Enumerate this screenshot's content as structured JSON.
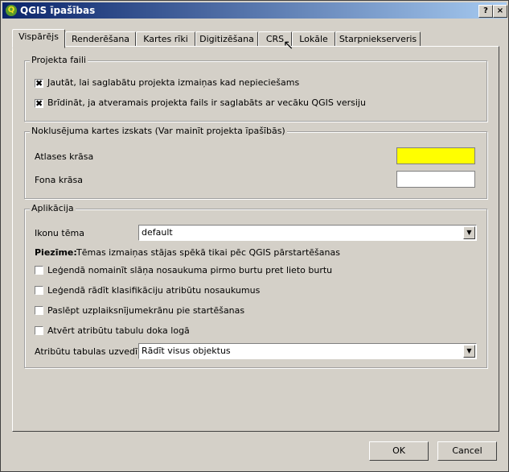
{
  "window": {
    "title": "QGIS īpašības",
    "help_label": "?",
    "close_label": "×",
    "app_icon_glyph": "Q"
  },
  "tabs": [
    {
      "label": "Vispārējs",
      "active": true
    },
    {
      "label": "Renderēšana"
    },
    {
      "label": "Kartes rīki"
    },
    {
      "label": "Digitizēšana"
    },
    {
      "label": "CRS"
    },
    {
      "label": "Lokāle"
    },
    {
      "label": "Starpniekserveris"
    }
  ],
  "project_files": {
    "title": "Projekta faili",
    "prompt_save": {
      "label": "Jautāt, lai saglabātu projekta izmaiņas kad nepieciešams",
      "checked": true
    },
    "warn_old": {
      "label": "Brīdināt, ja atveramais projekta fails ir saglabāts ar vecāku QGIS versiju",
      "checked": true
    }
  },
  "defaults": {
    "title": "Noklusējuma kartes izskats (Var mainīt projekta īpašībās)",
    "selection_color": {
      "label": "Atlases krāsa",
      "color": "#ffff00"
    },
    "background_color": {
      "label": "Fona krāsa",
      "color": "#ffffff"
    }
  },
  "application": {
    "title": "Aplikācija",
    "icon_theme": {
      "label": "Ikonu tēma",
      "value": "default"
    },
    "note_bold": "Piezīme:",
    "note_text": "Tēmas izmaiņas stājas spēkā tikai pēc QGIS pārstartēšanas",
    "checkboxes": [
      {
        "label": "Leģendā nomainīt slāņa nosaukuma pirmo burtu pret lieto burtu",
        "checked": false
      },
      {
        "label": "Leģendā rādīt klasifikāciju atribūtu nosaukumus",
        "checked": false
      },
      {
        "label": "Paslēpt uzplaiksnījumekrānu pie startēšanas",
        "checked": false
      },
      {
        "label": "Atvērt atribūtu tabulu doka logā",
        "checked": false
      }
    ],
    "attr_table": {
      "label": "Atribūtu tabulas uzvedība",
      "value": "Rādīt visus objektus"
    }
  },
  "buttons": {
    "ok": "OK",
    "cancel": "Cancel"
  },
  "glyphs": {
    "check": "✖",
    "arrow": "▼",
    "cursor": "↖"
  }
}
